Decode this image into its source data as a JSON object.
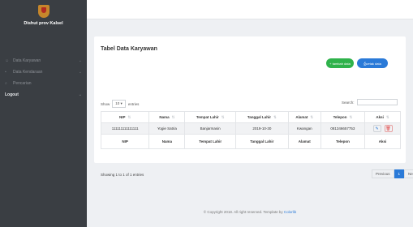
{
  "sidebar": {
    "brand": "Dishut prov Kalsel",
    "items": [
      {
        "label": "Data Karyawan",
        "icon": "user-icon"
      },
      {
        "label": "Data Kendaraan",
        "icon": "car-icon"
      },
      {
        "label": "Pencarian",
        "icon": "search-icon"
      },
      {
        "label": "Logout",
        "icon": ""
      }
    ]
  },
  "card": {
    "title": "Tabel Data Karyawan",
    "add_label": "+ tambah data",
    "print_label": "cetak data",
    "show": "Show",
    "entries_value": "10",
    "entries": "entries",
    "search_label": "Search:"
  },
  "table": {
    "headers": [
      "NIP",
      "Nama",
      "Tempat Lahir",
      "Tanggal Lahir",
      "Alamat",
      "Telepon",
      "Aksi"
    ],
    "rows": [
      [
        "111111111111111",
        "Yogie Satria",
        "Banjarmasin",
        "2019-10-30",
        "Kwangan",
        "081346657753"
      ]
    ],
    "footer": [
      "NIP",
      "Nama",
      "Tempat Lahir",
      "Tanggal Lahir",
      "Alamat",
      "Telepon",
      "Aksi"
    ]
  },
  "info": "Showing 1 to 1 of 1 entries",
  "pager": {
    "prev": "Previous",
    "page": "1",
    "next": "Next"
  },
  "footer": {
    "text": "© Copyright 2018. All right reserved. Template by ",
    "link": "Colorlib"
  }
}
